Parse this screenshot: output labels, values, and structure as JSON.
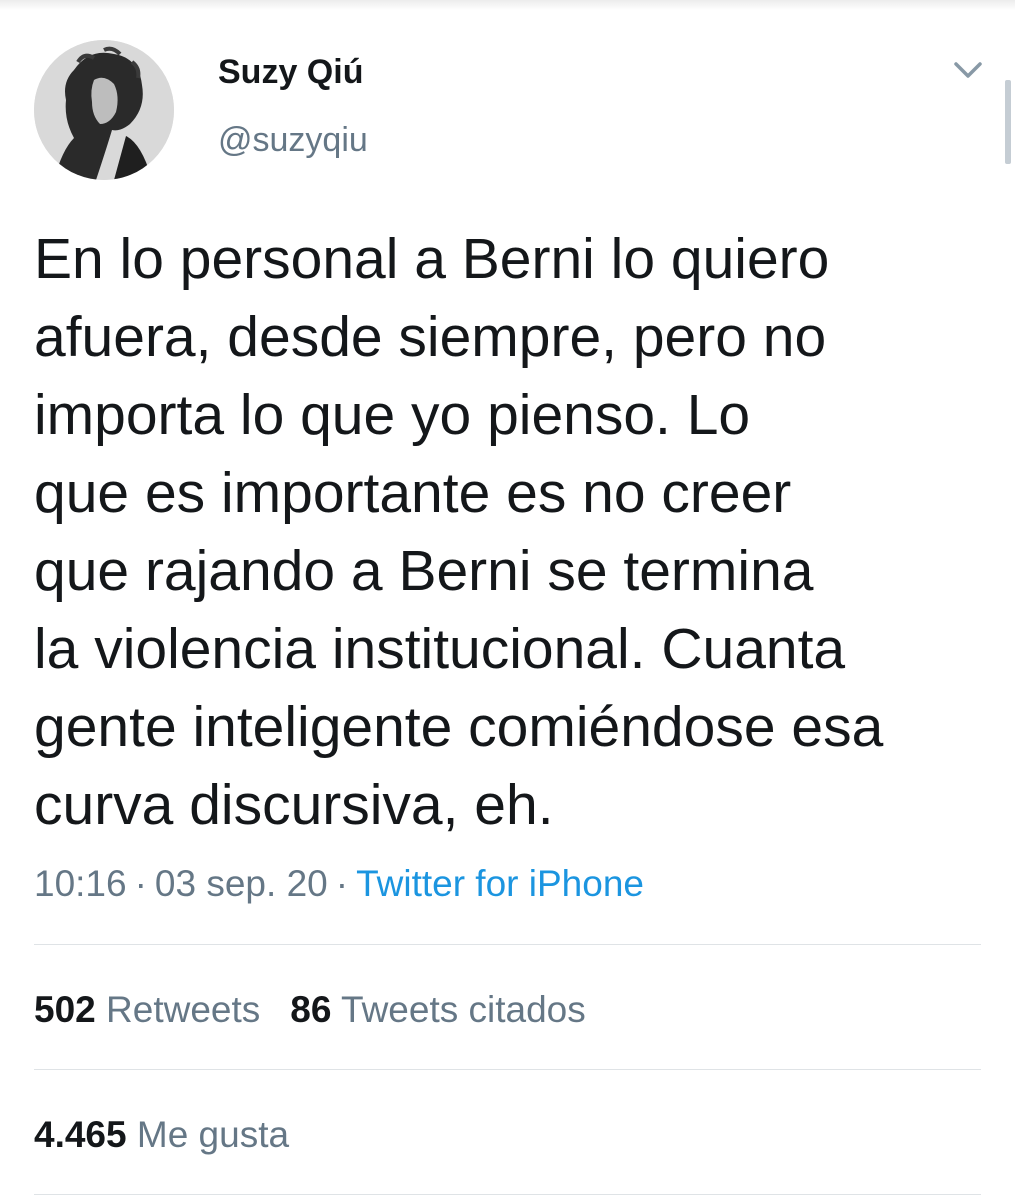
{
  "user": {
    "display_name": "Suzy Qiú",
    "handle": "@suzyqiu"
  },
  "icons": {
    "menu": "chevron-down-icon",
    "avatar": "profile-photo"
  },
  "tweet": {
    "lines": [
      "En lo personal a Berni lo quiero",
      "afuera, desde siempre, pero no",
      "importa lo que yo pienso. Lo",
      "que es importante es no creer",
      "que rajando a Berni se termina",
      "la violencia institucional. Cuanta",
      "gente inteligente comiéndose esa",
      "curva discursiva, eh."
    ],
    "time": "10:16",
    "date": "03 sep. 20",
    "separator": "·",
    "source": "Twitter for iPhone"
  },
  "stats": {
    "retweets_count": "502",
    "retweets_label": "Retweets",
    "quotes_count": "86",
    "quotes_label": "Tweets citados",
    "likes_count": "4.465",
    "likes_label": "Me gusta"
  },
  "colors": {
    "text": "#14171a",
    "secondary": "#657786",
    "link": "#1b95e0",
    "divider": "#dfe3e6"
  }
}
